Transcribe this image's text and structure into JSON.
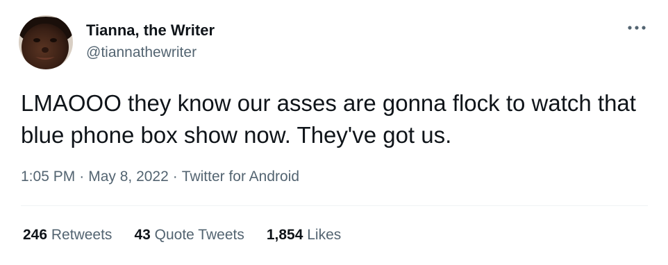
{
  "author": {
    "display_name": "Tianna, the Writer",
    "handle": "@tiannathewriter",
    "avatar_icon": "profile-photo"
  },
  "tweet": {
    "text": "LMAOOO they know our asses are gonna flock to watch that blue phone box show now. They've got us."
  },
  "meta": {
    "time": "1:05 PM",
    "separator": "·",
    "date": "May 8, 2022",
    "source": "Twitter for Android"
  },
  "stats": [
    {
      "count": "246",
      "label": "Retweets"
    },
    {
      "count": "43",
      "label": "Quote Tweets"
    },
    {
      "count": "1,854",
      "label": "Likes"
    }
  ],
  "icons": {
    "more": "more-options-icon"
  },
  "colors": {
    "text": "#0f1419",
    "muted": "#536471",
    "divider": "#eff3f4"
  }
}
